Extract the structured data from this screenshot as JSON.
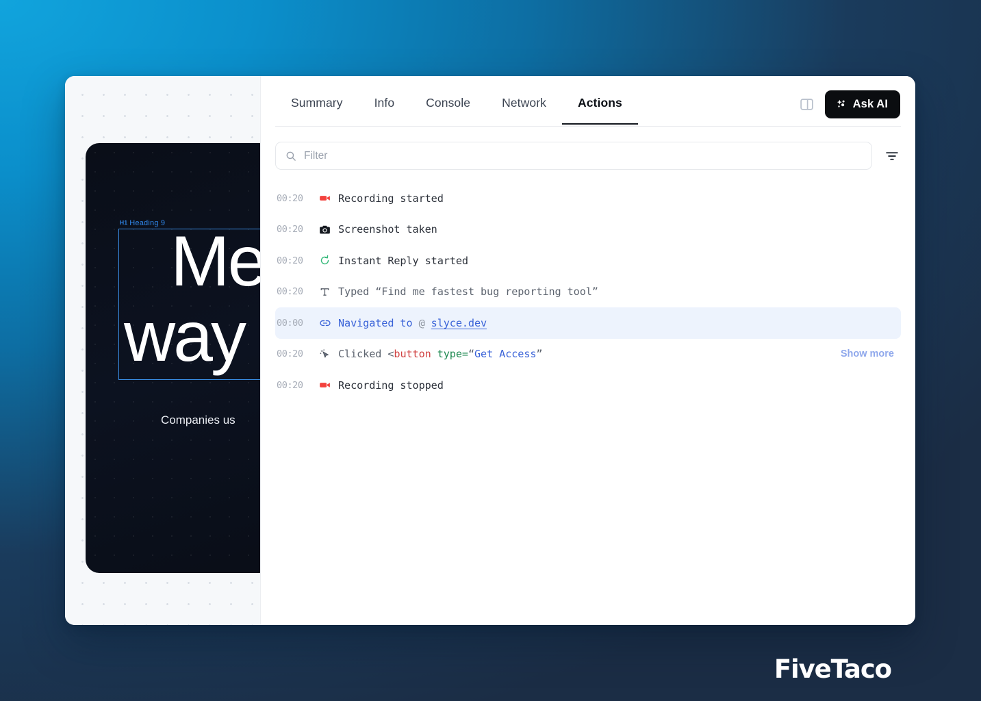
{
  "brand": {
    "watermark": "FiveTaco"
  },
  "colors": {
    "accent_blue": "#3a63d8",
    "highlight_row_bg": "#edf3fd",
    "tab_active_underline": "#14181f",
    "ask_ai_bg": "#0b0d10",
    "record_red": "#f3423d",
    "instant_green": "#35b97a",
    "show_more": "#8fa8ec",
    "bg_gradient_from": "#11a4dd",
    "bg_gradient_to": "#1b2d45"
  },
  "preview": {
    "element_tag_kind": "H1",
    "element_tag_label": "Heading 9",
    "hero_line_1": "Me",
    "hero_line_2": "way",
    "sub_text": "Companies us"
  },
  "header": {
    "tabs": [
      {
        "label": "Summary",
        "active": false
      },
      {
        "label": "Info",
        "active": false
      },
      {
        "label": "Console",
        "active": false
      },
      {
        "label": "Network",
        "active": false
      },
      {
        "label": "Actions",
        "active": true
      }
    ],
    "panel_toggle_icon": "panel-layout-icon",
    "ask_ai_label": "Ask AI",
    "ask_ai_icon": "sparkles-icon"
  },
  "filter": {
    "placeholder": "Filter",
    "value": "",
    "search_icon": "search-icon",
    "funnel_icon": "funnel-filter-icon"
  },
  "actions": {
    "show_more_label": "Show more",
    "rows": [
      {
        "time": "00:20",
        "icon": "video-camera-icon",
        "text": "Recording started",
        "highlight": false,
        "show_more": false
      },
      {
        "time": "00:20",
        "icon": "camera-icon",
        "text": "Screenshot taken",
        "highlight": false,
        "show_more": false
      },
      {
        "time": "00:20",
        "icon": "instant-reply-icon",
        "text": "Instant Reply started",
        "highlight": false,
        "show_more": false
      },
      {
        "time": "00:20",
        "icon": "type-text-icon",
        "text": "Typed “Find me fastest bug reporting tool”",
        "highlight": false,
        "show_more": false
      },
      {
        "time": "00:00",
        "icon": "link-icon",
        "text": "Navigated to @ slyce.dev",
        "prefix": "Navigated to",
        "at": "@",
        "url": "slyce.dev",
        "highlight": true,
        "show_more": false
      },
      {
        "time": "00:20",
        "icon": "cursor-click-icon",
        "text": "Clicked <button type=“Get Access”",
        "verb": "Clicked <",
        "tag": "button",
        "attr": " type=",
        "quote_open": "“",
        "value": "Get Access",
        "quote_close": "”",
        "highlight": false,
        "show_more": true
      },
      {
        "time": "00:20",
        "icon": "video-camera-icon",
        "text": "Recording stopped",
        "highlight": false,
        "show_more": false
      }
    ]
  }
}
